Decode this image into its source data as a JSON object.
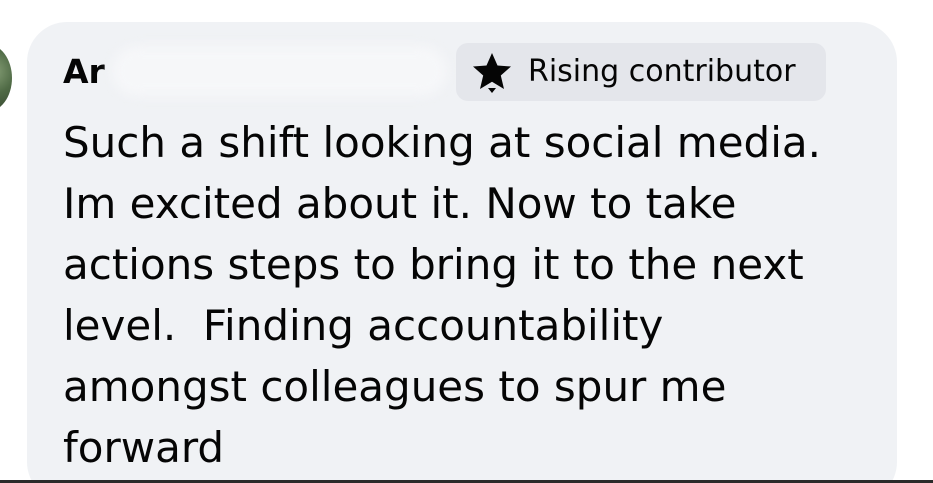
{
  "comment": {
    "author_visible": "Ar",
    "badge": {
      "label": "Rising contributor",
      "icon": "star-icon"
    },
    "lines": [
      "Such a shift looking at social media.",
      "Im excited about it. Now to take",
      "actions steps to bring it to the next",
      "level.  Finding accountability",
      "amongst colleagues to spur me",
      "forward"
    ]
  },
  "colors": {
    "bubble_background": "#f0f2f5",
    "badge_background": "#e4e6eb",
    "text": "#050505"
  }
}
